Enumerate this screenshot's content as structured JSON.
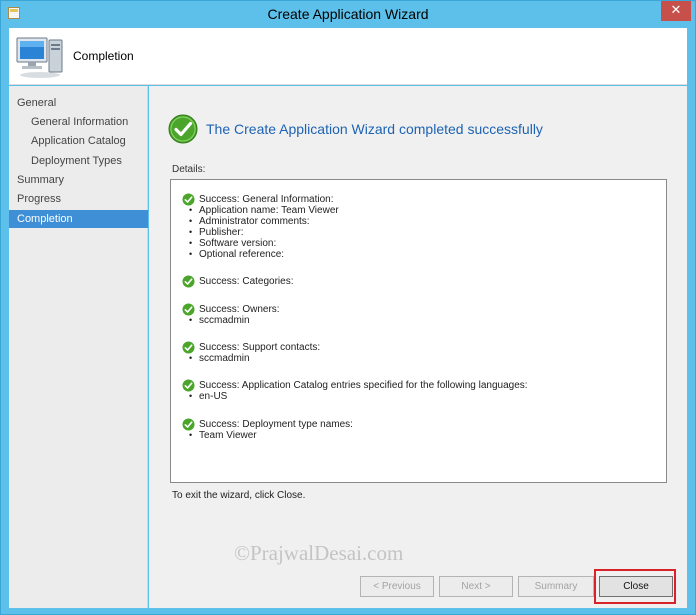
{
  "window": {
    "title": "Create Application Wizard",
    "close_glyph": "✕"
  },
  "header": {
    "title": "Completion",
    "icon": "computer-icon"
  },
  "nav": {
    "items": [
      {
        "label": "General",
        "sub": false,
        "active": false
      },
      {
        "label": "General Information",
        "sub": true,
        "active": false
      },
      {
        "label": "Application Catalog",
        "sub": true,
        "active": false
      },
      {
        "label": "Deployment Types",
        "sub": true,
        "active": false
      },
      {
        "label": "Summary",
        "sub": false,
        "active": false
      },
      {
        "label": "Progress",
        "sub": false,
        "active": false
      },
      {
        "label": "Completion",
        "sub": false,
        "active": true
      }
    ]
  },
  "main": {
    "headline": "The Create Application Wizard completed successfully",
    "details_label": "Details:",
    "details": [
      {
        "title": "Success: General Information:",
        "lines": [
          "Application name: Team Viewer",
          "Administrator comments:",
          "Publisher:",
          "Software version:",
          "Optional reference:"
        ]
      },
      {
        "title": "Success: Categories:",
        "lines": []
      },
      {
        "title": "Success: Owners:",
        "lines": [
          "sccmadmin"
        ]
      },
      {
        "title": "Success: Support contacts:",
        "lines": [
          "sccmadmin"
        ]
      },
      {
        "title": "Success: Application Catalog entries specified for the following languages:",
        "lines": [
          "en-US"
        ]
      },
      {
        "title": "Success: Deployment type names:",
        "lines": [
          "Team Viewer"
        ]
      }
    ],
    "exit_text": "To exit the wizard, click Close."
  },
  "watermark": "©PrajwalDesai.com",
  "buttons": {
    "previous": "< Previous",
    "next": "Next >",
    "summary": "Summary",
    "close": "Close"
  },
  "colors": {
    "accent": "#3e8fd6",
    "headline": "#1d63b3",
    "titlebar": "#5cc0ea",
    "highlight": "#d9222a",
    "success": "#4aa52a"
  }
}
